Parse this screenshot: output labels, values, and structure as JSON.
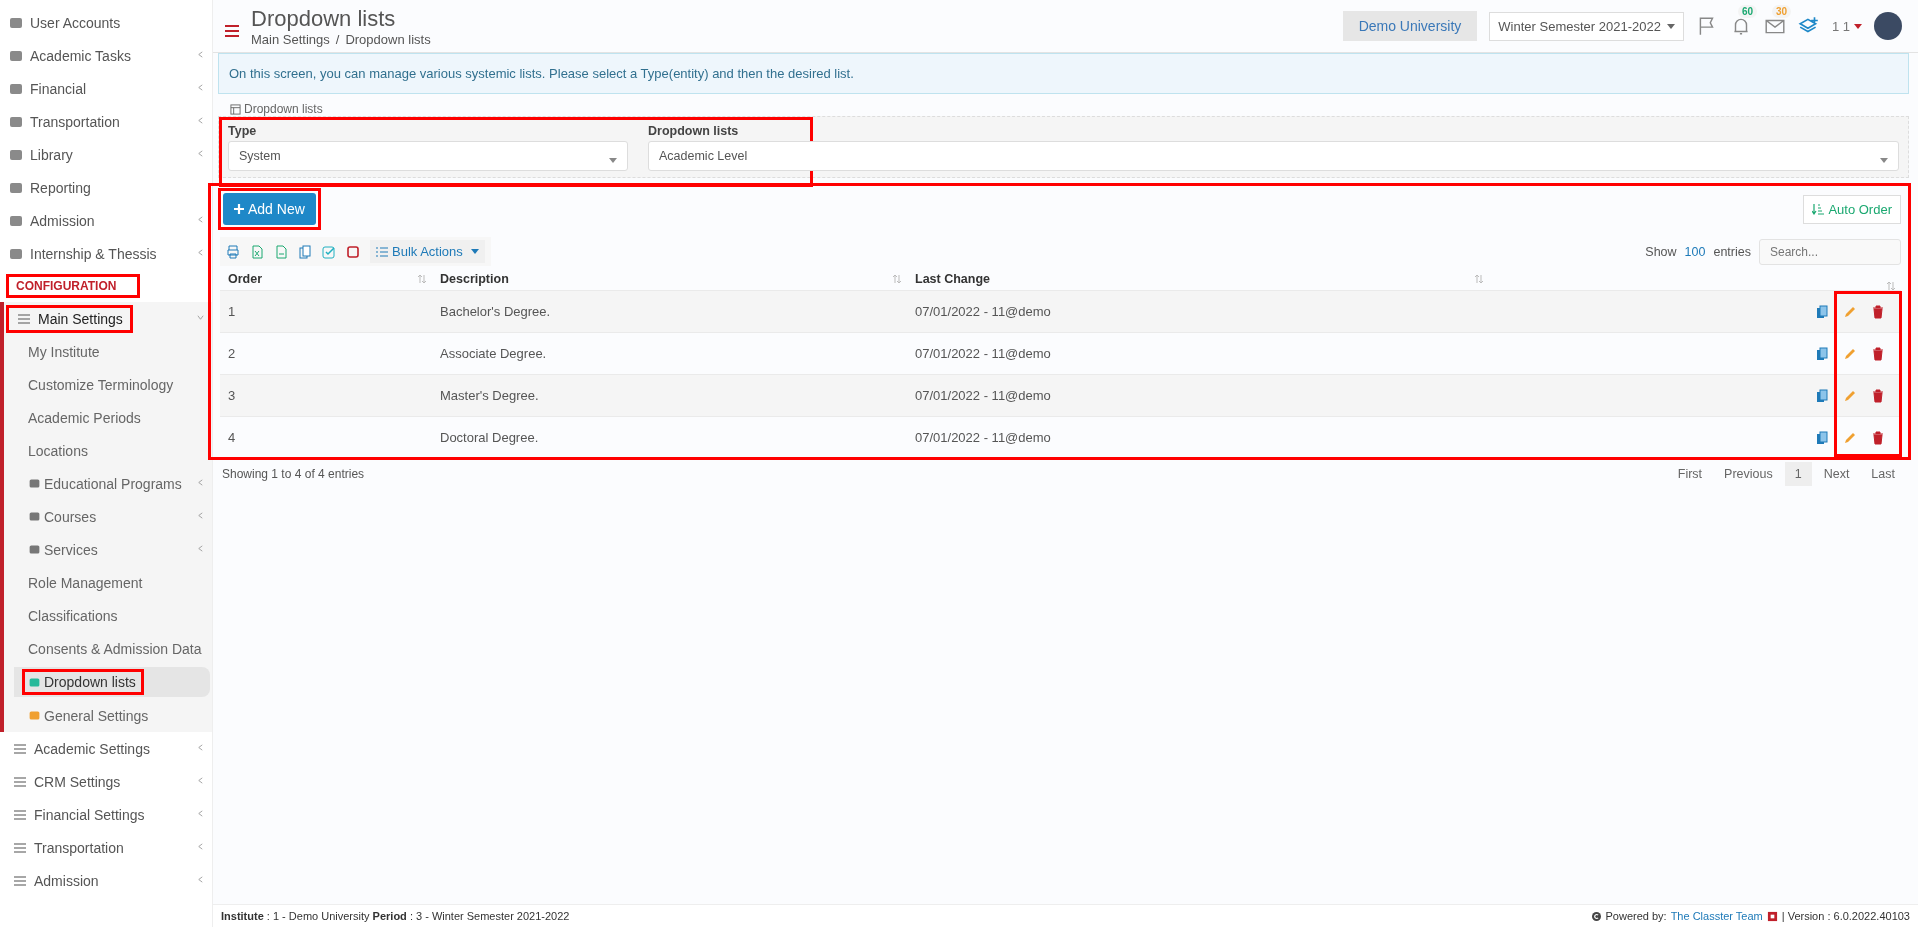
{
  "sidebar": {
    "items": [
      {
        "label": "User Accounts",
        "has_submenu": false,
        "selected": false,
        "highlighted": false
      },
      {
        "label": "Academic Tasks",
        "has_submenu": true,
        "selected": false,
        "highlighted": false
      },
      {
        "label": "Financial",
        "has_submenu": true,
        "selected": false,
        "highlighted": false
      },
      {
        "label": "Transportation",
        "has_submenu": true,
        "selected": false,
        "highlighted": false
      },
      {
        "label": "Library",
        "has_submenu": true,
        "selected": false,
        "highlighted": false
      },
      {
        "label": "Reporting",
        "has_submenu": false,
        "selected": false,
        "highlighted": false
      },
      {
        "label": "Admission",
        "has_submenu": true,
        "selected": false,
        "highlighted": false
      },
      {
        "label": "Internship & Thessis",
        "has_submenu": true,
        "selected": false,
        "highlighted": false
      }
    ],
    "section": {
      "label": "CONFIGURATION",
      "highlighted": true
    },
    "config_items": [
      {
        "label": "Main Settings",
        "has_submenu": true,
        "expanded": true,
        "highlighted": true,
        "children": [
          {
            "label": "My Institute",
            "has_submenu": false,
            "selected": false,
            "highlighted": false
          },
          {
            "label": "Customize Terminology",
            "has_submenu": false,
            "selected": false,
            "highlighted": false
          },
          {
            "label": "Academic Periods",
            "has_submenu": false,
            "selected": false,
            "highlighted": false
          },
          {
            "label": "Locations",
            "has_submenu": false,
            "selected": false,
            "highlighted": false
          },
          {
            "label": "Educational Programs",
            "has_submenu": true,
            "selected": false,
            "highlighted": false
          },
          {
            "label": "Courses",
            "has_submenu": true,
            "selected": false,
            "highlighted": false
          },
          {
            "label": "Services",
            "has_submenu": true,
            "selected": false,
            "highlighted": false
          },
          {
            "label": "Role Management",
            "has_submenu": false,
            "selected": false,
            "highlighted": false
          },
          {
            "label": "Classifications",
            "has_submenu": false,
            "selected": false,
            "highlighted": false
          },
          {
            "label": "Consents & Admission Data",
            "has_submenu": false,
            "selected": false,
            "highlighted": false
          },
          {
            "label": "Dropdown lists",
            "has_submenu": false,
            "selected": true,
            "highlighted": true
          },
          {
            "label": "General Settings",
            "has_submenu": false,
            "selected": false,
            "highlighted": false
          }
        ]
      },
      {
        "label": "Academic Settings",
        "has_submenu": true,
        "expanded": false,
        "highlighted": false
      },
      {
        "label": "CRM Settings",
        "has_submenu": true,
        "expanded": false,
        "highlighted": false
      },
      {
        "label": "Financial Settings",
        "has_submenu": true,
        "expanded": false,
        "highlighted": false
      },
      {
        "label": "Transportation",
        "has_submenu": true,
        "expanded": false,
        "highlighted": false
      },
      {
        "label": "Admission",
        "has_submenu": true,
        "expanded": false,
        "highlighted": false
      }
    ]
  },
  "header": {
    "title": "Dropdown lists",
    "breadcrumb": [
      "Main Settings",
      "Dropdown lists"
    ],
    "breadcrumb_separator": "/",
    "institution": "Demo University",
    "period": "Winter Semester 2021-2022",
    "notifications": "60",
    "messages": "30",
    "user": "1 1"
  },
  "info": "On this screen, you can manage various systemic lists. Please select a Type(entity) and then the desired list.",
  "filters": {
    "legend": "Dropdown lists",
    "highlighted": true,
    "fields": [
      {
        "label": "Type",
        "value": "System"
      },
      {
        "label": "Dropdown lists",
        "value": "Academic Level"
      }
    ]
  },
  "table_section": {
    "highlighted": true,
    "add_button": {
      "label": "Add New",
      "highlighted": true
    },
    "auto_order": "Auto Order",
    "bulk_actions": "Bulk Actions",
    "show": "Show",
    "page_size": "100",
    "entries": "entries",
    "search_placeholder": "Search...",
    "columns": [
      "Order",
      "Description",
      "Last Change"
    ],
    "actions_highlighted": true,
    "rows": [
      {
        "order": "1",
        "description": "Bachelor's Degree.",
        "last_change": "07/01/2022 - 11@demo"
      },
      {
        "order": "2",
        "description": "Associate Degree.",
        "last_change": "07/01/2022 - 11@demo"
      },
      {
        "order": "3",
        "description": "Master's Degree.",
        "last_change": "07/01/2022 - 11@demo"
      },
      {
        "order": "4",
        "description": "Doctoral Degree.",
        "last_change": "07/01/2022 - 11@demo"
      }
    ],
    "summary": "Showing 1 to 4 of 4 entries",
    "pagination": [
      {
        "label": "First",
        "selected": false
      },
      {
        "label": "Previous",
        "selected": false
      },
      {
        "label": "1",
        "selected": true
      },
      {
        "label": "Next",
        "selected": false
      },
      {
        "label": "Last",
        "selected": false
      }
    ]
  },
  "footer": {
    "context": "**Institute** : 1 - Demo University **Period** : 3 - Winter Semester 2021-2022",
    "powered_by": "Powered by:",
    "team": "The Classter Team",
    "version": "| Version : 6.0.2022.40103"
  }
}
